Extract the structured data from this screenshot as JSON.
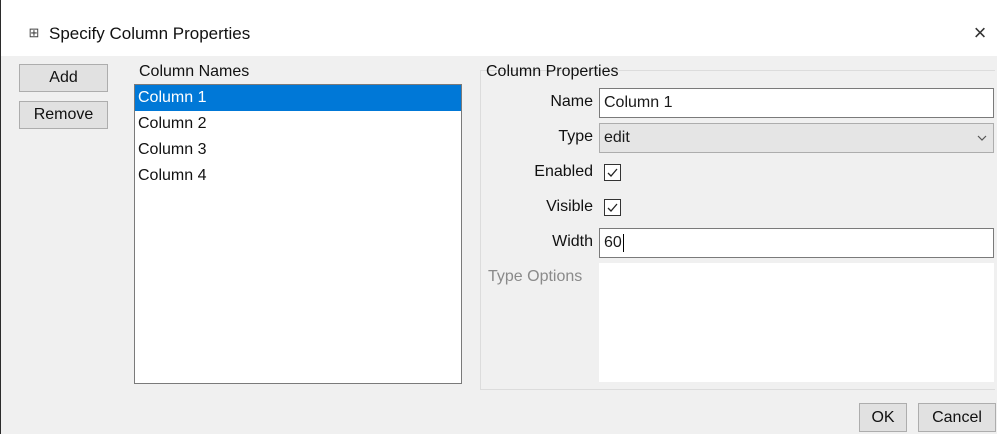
{
  "window": {
    "title": "Specify Column Properties",
    "icon": "table-icon",
    "close_glyph": "×"
  },
  "buttons": {
    "add": "Add",
    "remove": "Remove",
    "ok": "OK",
    "cancel": "Cancel"
  },
  "column_names": {
    "label": "Column Names",
    "items": [
      "Column 1",
      "Column 2",
      "Column 3",
      "Column 4"
    ],
    "selected_index": 0
  },
  "properties": {
    "group_label": "Column Properties",
    "name_label": "Name",
    "name_value": "Column 1",
    "type_label": "Type",
    "type_value": "edit",
    "enabled_label": "Enabled",
    "enabled_checked": true,
    "visible_label": "Visible",
    "visible_checked": true,
    "width_label": "Width",
    "width_value": "60",
    "type_options_label": "Type Options",
    "type_options_value": ""
  },
  "colors": {
    "selection": "#0078d7",
    "dialog_bg": "#f0f0f0"
  }
}
